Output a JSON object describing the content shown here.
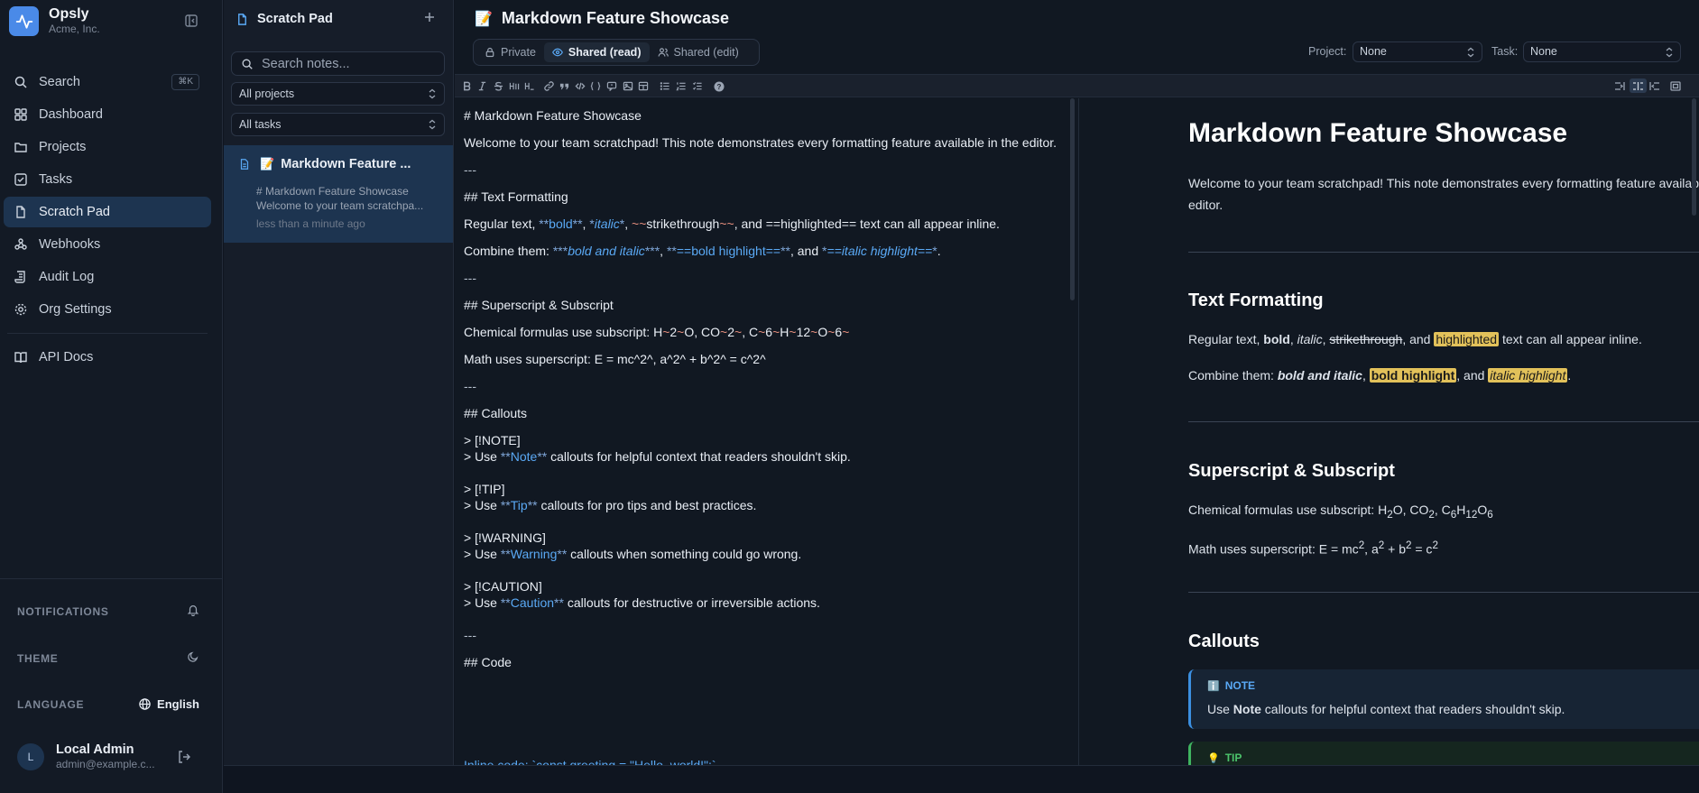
{
  "brand": {
    "name": "Opsly",
    "org": "Acme, Inc."
  },
  "nav": {
    "search": "Search",
    "search_shortcut": "⌘K",
    "items": [
      "Dashboard",
      "Projects",
      "Tasks",
      "Scratch Pad",
      "Webhooks",
      "Audit Log",
      "Org Settings"
    ],
    "api_docs": "API Docs"
  },
  "sidebar_bottom": {
    "notifications": "NOTIFICATIONS",
    "theme": "THEME",
    "language": "LANGUAGE",
    "language_value": "English"
  },
  "user": {
    "initial": "L",
    "name": "Local Admin",
    "email": "admin@example.c..."
  },
  "notes_panel": {
    "title": "Scratch Pad",
    "search_placeholder": "Search notes...",
    "project_filter": "All projects",
    "task_filter": "All tasks",
    "note": {
      "emoji": "📝",
      "title": "Markdown Feature ...",
      "preview_1": "# Markdown Feature Showcase",
      "preview_2": "Welcome to your team scratchpa...",
      "time": "less than a minute ago"
    }
  },
  "editor": {
    "emoji": "📝",
    "title": "Markdown Feature Showcase",
    "visibility": [
      "Private",
      "Shared (read)",
      "Shared (edit)"
    ],
    "project_label": "Project:",
    "project_value": "None",
    "task_label": "Task:",
    "task_value": "None"
  },
  "source": {
    "l1": "# Markdown Feature Showcase",
    "l2": "Welcome to your team scratchpad! This note demonstrates every formatting feature available in the editor.",
    "hr": "---",
    "h_text": "## Text Formatting",
    "tf_regular": "Regular text, ",
    "tf_bold": "bold",
    "tf_italic": "italic",
    "tf_strike": "strikethrough",
    "tf_and": ", and ==highlighted== text can all appear inline.",
    "cb_combine": "Combine them: ",
    "cb_bi": "bold and italic",
    "cb_bh": "==bold highlight==",
    "cb_and": ", and ",
    "cb_ih": "==italic highlight==",
    "h_sup": "## Superscript & Subscript",
    "chem": "Chemical formulas use subscript: H",
    "math": "Math uses superscript: E = mc^2^, a^2^ + b^2^ = c^2^",
    "h_callouts": "## Callouts",
    "note_tag": "> [!NOTE]",
    "note_use": "> Use ",
    "note_word": "Note",
    "note_rest": " callouts for helpful context that readers shouldn't skip.",
    "tip_tag": "> [!TIP]",
    "tip_word": "Tip",
    "tip_rest": " callouts for pro tips and best practices.",
    "warn_tag": "> [!WARNING]",
    "warn_word": "Warning",
    "warn_rest": " callouts when something could go wrong.",
    "caut_tag": "> [!CAUTION]",
    "caut_word": "Caution",
    "caut_rest": " callouts for destructive or irreversible actions.",
    "h_code": "## Code",
    "inline_code": "Inline code: `const greeting = \"Hello, world!\";`"
  },
  "preview": {
    "h1": "Markdown Feature Showcase",
    "intro": "Welcome to your team scratchpad! This note demonstrates every formatting feature available in the editor.",
    "h_text": "Text Formatting",
    "regular": "Regular text, ",
    "bold": "bold",
    "italic": "italic",
    "strike": "strikethrough",
    "highlighted": "highlighted",
    "inline_rest": " text can all appear inline.",
    "combine": "Combine them: ",
    "bold_italic": "bold and italic",
    "bold_highlight": "bold highlight",
    "italic_highlight": "italic highlight",
    "h_sup": "Superscript & Subscript",
    "chem": "Chemical formulas use subscript: ",
    "math": "Math uses superscript: E = mc",
    "h_callouts": "Callouts",
    "note_title": "NOTE",
    "note_body_pre": "Use ",
    "note_body_word": "Note",
    "note_body_rest": " callouts for helpful context that readers shouldn't skip.",
    "tip_title": "TIP"
  }
}
